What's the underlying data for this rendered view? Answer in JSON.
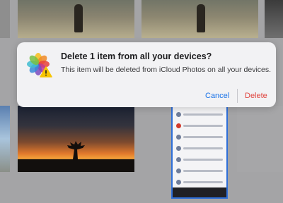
{
  "alert": {
    "title": "Delete 1 item from all your devices?",
    "message": "This item will be deleted from iCloud Photos on all your devices.",
    "cancel_label": "Cancel",
    "delete_label": "Delete",
    "app_icon": "photos-icon",
    "warning_icon": "warning-icon"
  },
  "colors": {
    "accent": "#1a73e8",
    "destructive": "#e0453f",
    "alert_background": "#f2f2f4",
    "selection_border": "#2f6fd8"
  }
}
